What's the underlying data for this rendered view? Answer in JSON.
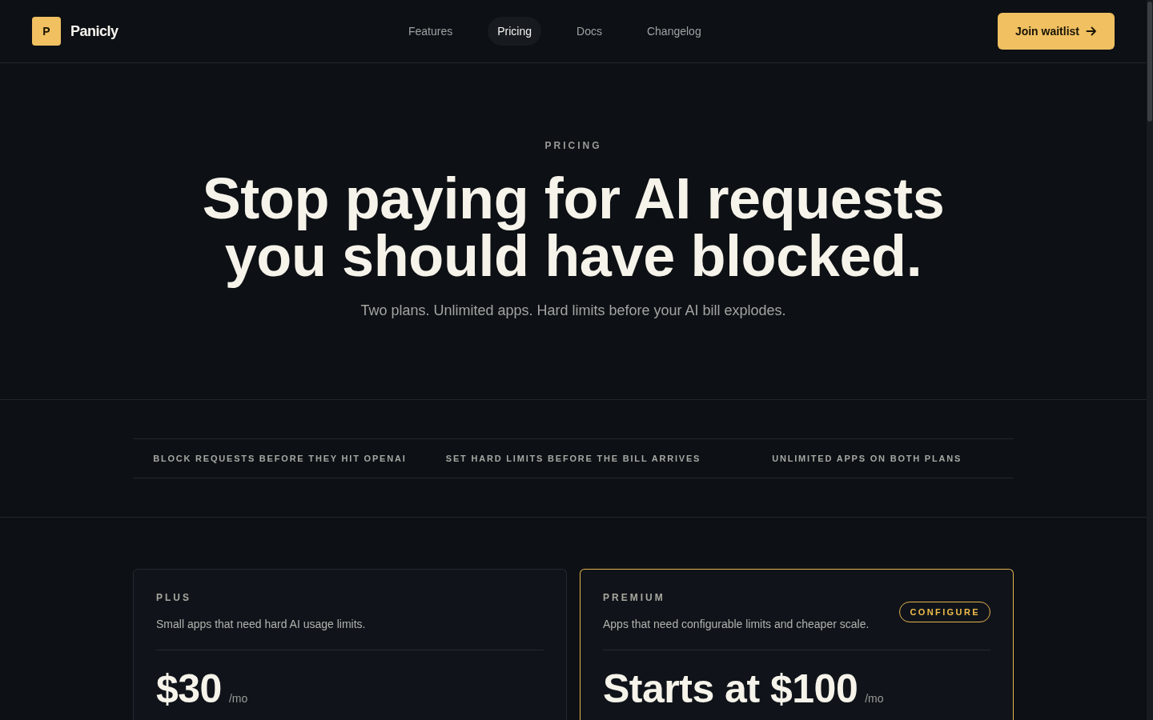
{
  "header": {
    "logo": {
      "mark": "P",
      "name": "Panicly"
    },
    "nav": [
      {
        "label": "Features",
        "selected": false
      },
      {
        "label": "Pricing",
        "selected": true
      },
      {
        "label": "Docs",
        "selected": false
      },
      {
        "label": "Changelog",
        "selected": false
      }
    ],
    "cta": "Join waitlist"
  },
  "hero": {
    "eyebrow": "PRICING",
    "title_lines": [
      "Stop paying for AI requests",
      "you should have blocked."
    ],
    "subtitle": "Two plans. Unlimited apps. Hard limits before your AI bill explodes."
  },
  "highlights": [
    "BLOCK REQUESTS BEFORE THEY HIT OPENAI",
    "SET HARD LIMITS BEFORE THE BILL ARRIVES",
    "UNLIMITED APPS ON BOTH PLANS"
  ],
  "plans": [
    {
      "name": "PLUS",
      "description": "Small apps that need hard AI usage limits.",
      "price": "$30",
      "period": "/mo",
      "featured": false
    },
    {
      "name": "PREMIUM",
      "description": "Apps that need configurable limits and cheaper scale.",
      "tag": "CONFIGURE",
      "price": "Starts at $100",
      "period": "/mo",
      "featured": true
    }
  ]
}
